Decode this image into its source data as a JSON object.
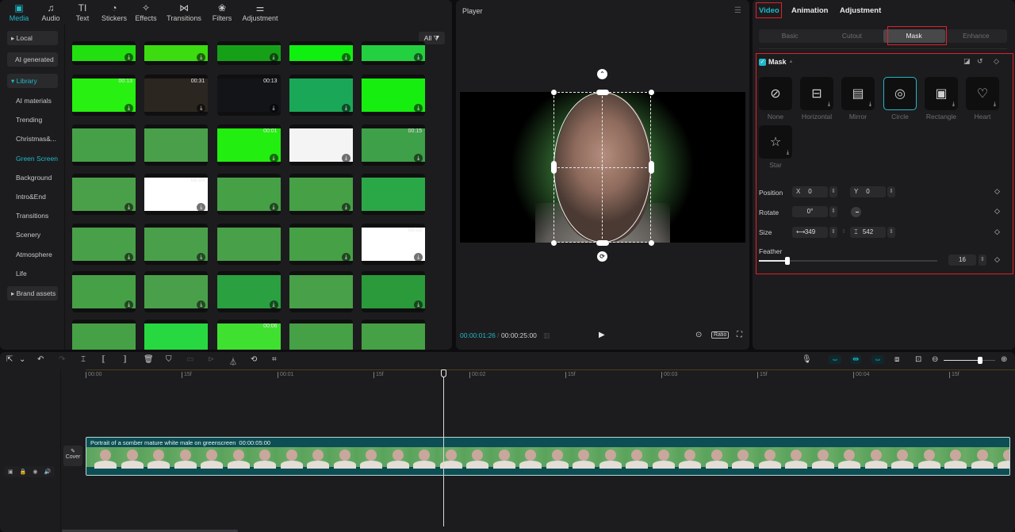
{
  "media_panel": {
    "tabs": [
      {
        "label": "Media",
        "icon": "▣",
        "active": true
      },
      {
        "label": "Audio",
        "icon": "♫"
      },
      {
        "label": "Text",
        "icon": "TI"
      },
      {
        "label": "Stickers",
        "icon": "◔"
      },
      {
        "label": "Effects",
        "icon": "✧"
      },
      {
        "label": "Transitions",
        "icon": "⋈"
      },
      {
        "label": "Filters",
        "icon": "❀"
      },
      {
        "label": "Adjustment",
        "icon": "⚌"
      }
    ],
    "nav": {
      "local": "▸ Local",
      "ai_generated": "AI generated",
      "library": "▾ Library",
      "items": [
        "AI materials",
        "Trending",
        "Christmas&...",
        "Green Screen",
        "Background",
        "Intro&End",
        "Transitions",
        "Scenery",
        "Atmosphere",
        "Life"
      ],
      "active_item": "Green Screen",
      "brand_assets": "▸ Brand assets"
    },
    "filter_label": "All ⧩",
    "thumbnails": [
      {
        "row": 0,
        "col": 0,
        "color": "#22e010",
        "duration": "",
        "download": true
      },
      {
        "row": 0,
        "col": 1,
        "color": "#3ddc10",
        "duration": "",
        "download": true
      },
      {
        "row": 0,
        "col": 2,
        "color": "#16a018",
        "duration": "",
        "download": true
      },
      {
        "row": 0,
        "col": 3,
        "color": "#10f010",
        "duration": "",
        "download": true
      },
      {
        "row": 0,
        "col": 4,
        "color": "#22d040",
        "duration": "",
        "download": true
      },
      {
        "row": 1,
        "col": 0,
        "color": "#28f010",
        "duration": "00:13",
        "download": true
      },
      {
        "row": 1,
        "col": 1,
        "color": "#2c2620",
        "duration": "00:31",
        "download": true
      },
      {
        "row": 1,
        "col": 2,
        "color": "#121418",
        "duration": "00:13",
        "download": true
      },
      {
        "row": 1,
        "col": 3,
        "color": "#1aa858",
        "duration": "",
        "download": true
      },
      {
        "row": 1,
        "col": 4,
        "color": "#16ee10",
        "duration": "",
        "download": true
      },
      {
        "row": 2,
        "col": 0,
        "color": "#46a048",
        "duration": "",
        "download": false
      },
      {
        "row": 2,
        "col": 1,
        "color": "#4aa04a",
        "duration": "",
        "download": false
      },
      {
        "row": 2,
        "col": 2,
        "color": "#22ee10",
        "duration": "00:01",
        "download": true
      },
      {
        "row": 2,
        "col": 3,
        "color": "#f4f4f4",
        "duration": "",
        "download": true
      },
      {
        "row": 2,
        "col": 4,
        "color": "#3ea048",
        "duration": "00:15",
        "download": true
      },
      {
        "row": 3,
        "col": 0,
        "color": "#4aa048",
        "duration": "",
        "download": true
      },
      {
        "row": 3,
        "col": 1,
        "color": "#ffffff",
        "duration": "00:05",
        "download": true
      },
      {
        "row": 3,
        "col": 2,
        "color": "#46a046",
        "duration": "",
        "download": true
      },
      {
        "row": 3,
        "col": 3,
        "color": "#46a046",
        "duration": "",
        "download": true
      },
      {
        "row": 3,
        "col": 4,
        "color": "#2aa848",
        "duration": "",
        "download": false
      },
      {
        "row": 4,
        "col": 0,
        "color": "#48a048",
        "duration": "",
        "download": true
      },
      {
        "row": 4,
        "col": 1,
        "color": "#4aa04a",
        "duration": "",
        "download": true
      },
      {
        "row": 4,
        "col": 2,
        "color": "#48a048",
        "duration": "",
        "download": false
      },
      {
        "row": 4,
        "col": 3,
        "color": "#46a046",
        "duration": "",
        "download": true
      },
      {
        "row": 4,
        "col": 4,
        "color": "#ffffff",
        "duration": "00:05",
        "download": true
      },
      {
        "row": 5,
        "col": 0,
        "color": "#46a046",
        "duration": "",
        "download": true
      },
      {
        "row": 5,
        "col": 1,
        "color": "#4aa04a",
        "duration": "",
        "download": true
      },
      {
        "row": 5,
        "col": 2,
        "color": "#2aa040",
        "duration": "",
        "download": true
      },
      {
        "row": 5,
        "col": 3,
        "color": "#48a048",
        "duration": "",
        "download": false
      },
      {
        "row": 5,
        "col": 4,
        "color": "#2a9a3a",
        "duration": "",
        "download": true
      },
      {
        "row": 6,
        "col": 0,
        "color": "#46a046",
        "duration": "",
        "download": false
      },
      {
        "row": 6,
        "col": 1,
        "color": "#28d840",
        "duration": "",
        "download": false
      },
      {
        "row": 6,
        "col": 2,
        "color": "#40e030",
        "duration": "00:06",
        "download": false
      },
      {
        "row": 6,
        "col": 3,
        "color": "#46a046",
        "duration": "",
        "download": false
      },
      {
        "row": 6,
        "col": 4,
        "color": "#46a046",
        "duration": "",
        "download": false
      }
    ]
  },
  "player": {
    "title": "Player",
    "menu_icon": "☰",
    "current_time": "00:00:01:26",
    "separator": "/",
    "total_time": "00:00:25:00",
    "layout_icon": "▥",
    "play_icon": "▶",
    "zoom_fit_icon": "⊙",
    "ratio_label": "Ratio",
    "fullscreen_icon": "⛶",
    "top_handle_icon": "⌃",
    "rotate_handle_icon": "⟳"
  },
  "properties": {
    "tabs": [
      "Video",
      "Animation",
      "Adjustment"
    ],
    "active_tab": "Video",
    "subtabs": [
      "Basic",
      "Cutout",
      "Mask",
      "Enhance"
    ],
    "active_subtab": "Mask",
    "mask": {
      "title": "Mask",
      "enabled": true,
      "header_icons": {
        "invert": "◪",
        "reset": "↺",
        "keyframe": "◇"
      },
      "options": [
        {
          "label": "None",
          "icon": "⊘",
          "download": false
        },
        {
          "label": "Horizontal",
          "icon": "⊟",
          "download": true
        },
        {
          "label": "Mirror",
          "icon": "▤",
          "download": true
        },
        {
          "label": "Circle",
          "icon": "◎",
          "download": false,
          "selected": true
        },
        {
          "label": "Rectangle",
          "icon": "▣",
          "download": true
        },
        {
          "label": "Heart",
          "icon": "♡",
          "download": true
        },
        {
          "label": "Star",
          "icon": "☆",
          "download": true
        }
      ],
      "position": {
        "label": "Position",
        "x_label": "X",
        "x": "0",
        "y_label": "Y",
        "y": "0"
      },
      "rotate": {
        "label": "Rotate",
        "value": "0°"
      },
      "size": {
        "label": "Size",
        "width_icon": "⟷",
        "width": "349",
        "height_icon": "⌶",
        "height": "542"
      },
      "feather": {
        "label": "Feather",
        "value": "16",
        "fraction": 0.16
      }
    }
  },
  "timeline": {
    "toolbar_left": [
      "⇱",
      "⌄",
      "↶",
      "↷",
      "⌶",
      "⟦",
      "⟧",
      "🗑",
      "⛉",
      "▭",
      "⊳",
      "⏃",
      "⟲",
      "⌗"
    ],
    "toolbar_right": {
      "mic": "🎙",
      "link1": "⇔",
      "link2": "⇹",
      "link3": "⇔",
      "split": "⧈",
      "preview": "⊡",
      "zoom_out": "⊖",
      "zoom_in": "⊕",
      "zoom_fraction": 0.7
    },
    "ruler": [
      {
        "label": "00:00"
      },
      {
        "label": "15f"
      },
      {
        "label": "00:01"
      },
      {
        "label": "15f"
      },
      {
        "label": "00:02"
      },
      {
        "label": "15f"
      },
      {
        "label": "00:03"
      },
      {
        "label": "15f"
      },
      {
        "label": "00:04"
      },
      {
        "label": "15f"
      }
    ],
    "track_controls": [
      "▣",
      "🔒",
      "◉",
      "🔊"
    ],
    "cover_icon": "✎",
    "cover_label": "Cover",
    "clip": {
      "title": "Portrait of a somber mature white male on greenscreen",
      "duration": "00:00:05:00"
    }
  },
  "colors": {
    "accent": "#22b8c8",
    "highlight_box": "#e0202a",
    "clip_bg": "#0d4e54"
  }
}
